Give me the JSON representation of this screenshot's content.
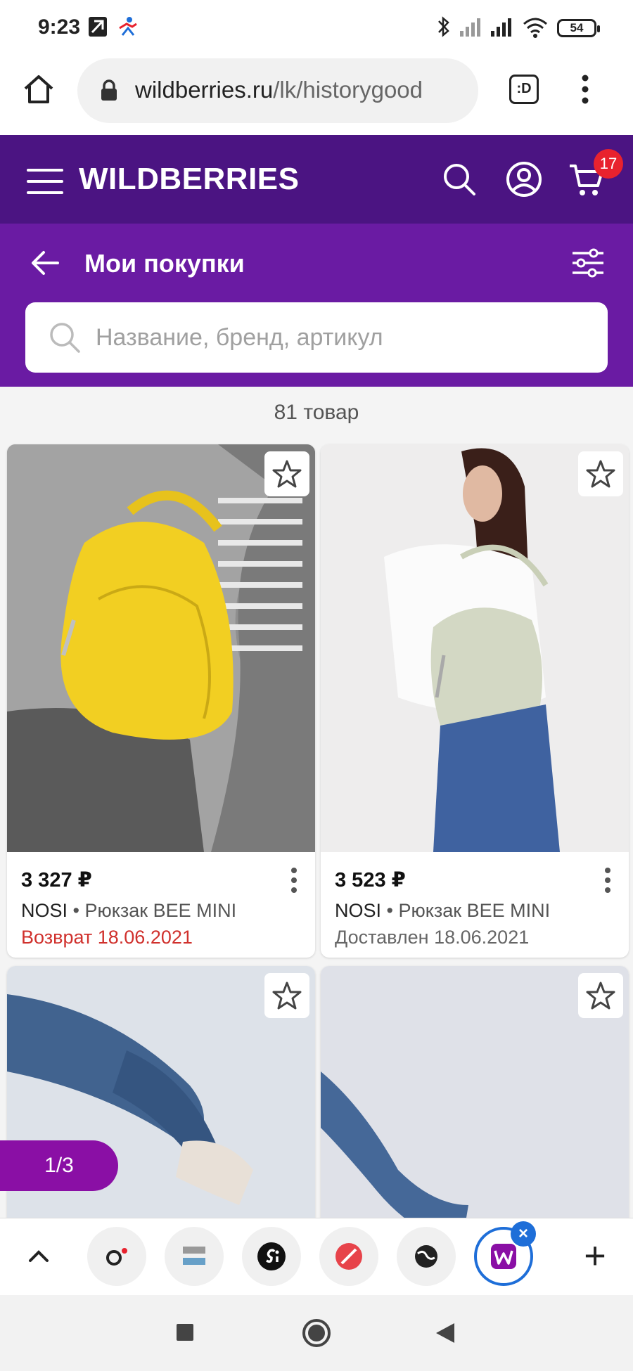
{
  "status_bar": {
    "time": "9:23",
    "battery": "54",
    "icons": [
      "app-notification-icon",
      "sports-app-icon",
      "bluetooth-icon",
      "signal-icon",
      "signal-icon",
      "wifi-icon"
    ]
  },
  "browser": {
    "url_domain": "wildberries.ru",
    "url_path": "/lk/historygood",
    "tab_switcher_label": ":D"
  },
  "header": {
    "logo": "WILDBERRIES",
    "cart_count": "17",
    "brand_color": "#4b1482"
  },
  "subheader": {
    "title": "Мои покупки",
    "search_placeholder": "Название, бренд, артикул",
    "bg_color": "#6a1ba3"
  },
  "list": {
    "count_label": "81 товар",
    "items": [
      {
        "price": "3 327 ₽",
        "brand": "NOSI",
        "separator": " • ",
        "product": "Рюкзак BEE MINI",
        "status": "Возврат 18.06.2021",
        "status_color": "#d0312d"
      },
      {
        "price": "3 523 ₽",
        "brand": "NOSI",
        "separator": " • ",
        "product": "Рюкзак BEE MINI",
        "status": "Доставлен 18.06.2021",
        "status_color": "#666666"
      }
    ]
  },
  "pager": {
    "label": "1/3"
  },
  "tabs": {
    "items": [
      "opera-icon",
      "half-finger-icon",
      "si-icon",
      "compass-icon",
      "globe-icon",
      "wildberries-icon"
    ],
    "close_label": "×",
    "add_label": "+"
  }
}
